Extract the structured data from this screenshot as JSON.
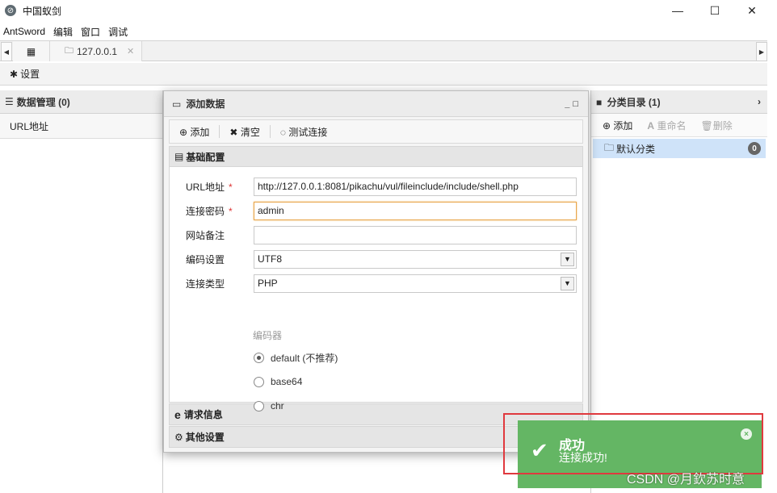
{
  "window": {
    "title": "中国蚁剑",
    "min": "—",
    "max": "☐",
    "close": "✕"
  },
  "menu": [
    "AntSword",
    "编辑",
    "窗口",
    "调试"
  ],
  "tabs": {
    "home_icon": "▦",
    "host": "127.0.0.1",
    "close": "✕"
  },
  "settings": {
    "label": "设置"
  },
  "left_panel": {
    "header": "数据管理 (0)",
    "column": "URL地址"
  },
  "dialog": {
    "title": "添加数据",
    "toolbar": {
      "add": "添加",
      "clear": "清空",
      "test": "测试连接"
    },
    "section_basic": "基础配置",
    "fields": {
      "url_label": "URL地址",
      "url_value": "http://127.0.0.1:8081/pikachu/vul/fileinclude/include/shell.php",
      "pwd_label": "连接密码",
      "pwd_value": "admin",
      "note_label": "网站备注",
      "note_value": "",
      "encoding_label": "编码设置",
      "encoding_value": "UTF8",
      "type_label": "连接类型",
      "type_value": "PHP"
    },
    "encoder_label": "编码器",
    "encoders": [
      "default (不推荐)",
      "base64",
      "chr"
    ],
    "section_request": "请求信息",
    "section_other": "其他设置"
  },
  "right_panel": {
    "header": "分类目录 (1)",
    "add": "添加",
    "rename": "重命名",
    "delete": "删除",
    "default_category": "默认分类",
    "count": "0"
  },
  "toast": {
    "title": "成功",
    "message": "连接成功!",
    "close": "×"
  },
  "watermark": "CSDN @月欽苏时意",
  "colors": {
    "toast_bg": "#64b664",
    "highlight": "#e0393e",
    "selected": "#cfe3f9",
    "focus_border": "#e8a54a"
  }
}
